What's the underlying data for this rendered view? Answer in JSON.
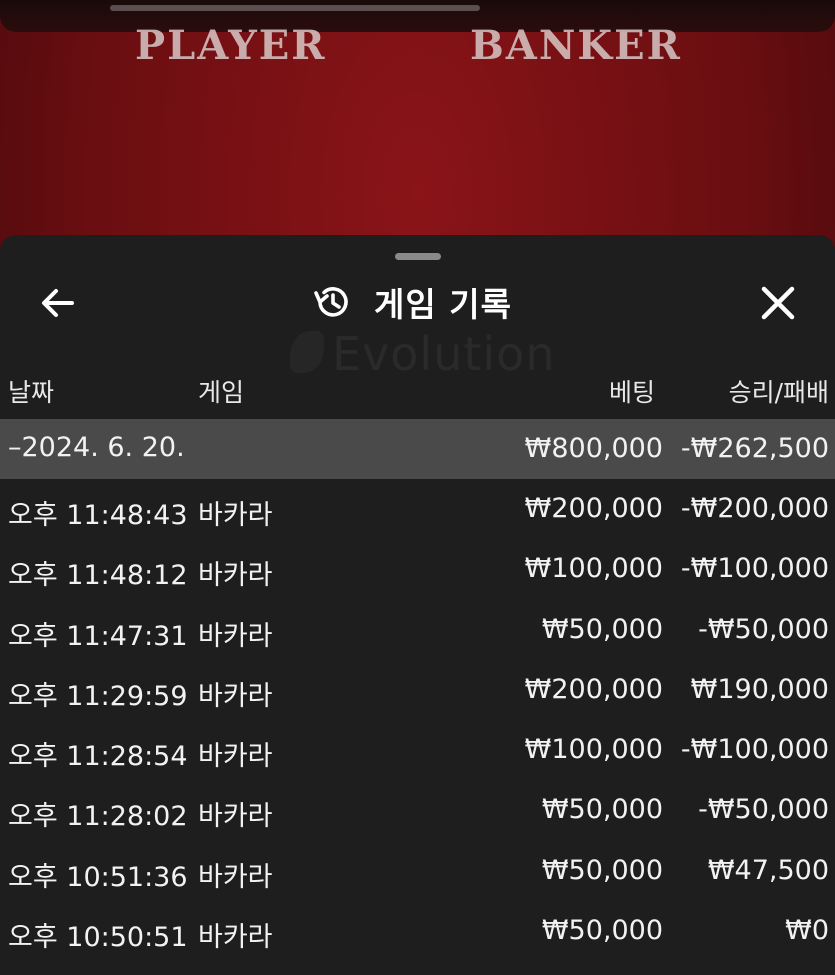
{
  "background": {
    "player_label": "PLAYER",
    "banker_label": "BANKER"
  },
  "sheet": {
    "title": "게임 기록",
    "watermark": "Evolution",
    "icons": {
      "back": "arrow-left-icon",
      "history": "history-clock-icon",
      "close": "close-x-icon"
    }
  },
  "columns": {
    "date": "날짜",
    "game": "게임",
    "bet": "베팅",
    "result": "승리/패배"
  },
  "summary": {
    "date": "–2024. 6. 20.",
    "bet": "₩800,000",
    "result": "-₩262,500"
  },
  "rows": [
    {
      "time": "오후 11:48:43",
      "game": "바카라",
      "bet": "₩200,000",
      "result": "-₩200,000"
    },
    {
      "time": "오후 11:48:12",
      "game": "바카라",
      "bet": "₩100,000",
      "result": "-₩100,000"
    },
    {
      "time": "오후 11:47:31",
      "game": "바카라",
      "bet": "₩50,000",
      "result": "-₩50,000"
    },
    {
      "time": "오후 11:29:59",
      "game": "바카라",
      "bet": "₩200,000",
      "result": "₩190,000"
    },
    {
      "time": "오후 11:28:54",
      "game": "바카라",
      "bet": "₩100,000",
      "result": "-₩100,000"
    },
    {
      "time": "오후 11:28:02",
      "game": "바카라",
      "bet": "₩50,000",
      "result": "-₩50,000"
    },
    {
      "time": "오후 10:51:36",
      "game": "바카라",
      "bet": "₩50,000",
      "result": "₩47,500"
    },
    {
      "time": "오후 10:50:51",
      "game": "바카라",
      "bet": "₩50,000",
      "result": "₩0"
    }
  ],
  "colors": {
    "sheet_bg": "#1e1e1e",
    "summary_bg": "#4a4a4a",
    "table_bg": "#7a1014",
    "text": "#f2f2f2"
  }
}
